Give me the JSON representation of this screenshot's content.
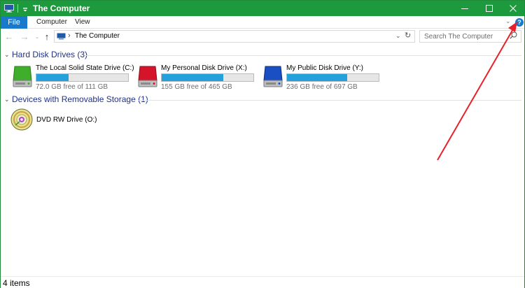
{
  "window": {
    "title": "The Computer"
  },
  "ribbon": {
    "file_label": "File",
    "tabs": [
      "Computer",
      "View"
    ],
    "help_glyph": "?"
  },
  "nav": {
    "crumb": "The Computer"
  },
  "search": {
    "placeholder": "Search The Computer"
  },
  "groups": [
    {
      "title": "Hard Disk Drives (3)"
    },
    {
      "title": "Devices with Removable Storage (1)"
    }
  ],
  "drives": [
    {
      "name": "The Local Solid State Drive (C:)",
      "free_text": "72.0 GB free of 111 GB",
      "used_fraction": 0.35,
      "icon": "green-hard-drive-icon",
      "color": "#3fae2a"
    },
    {
      "name": "My Personal Disk Drive (X:)",
      "free_text": "155 GB free of 465 GB",
      "used_fraction": 0.67,
      "icon": "red-hard-drive-icon",
      "color": "#d5142a"
    },
    {
      "name": "My Public Disk Drive (Y:)",
      "free_text": "236 GB free of 697 GB",
      "used_fraction": 0.66,
      "icon": "blue-hard-drive-icon",
      "color": "#1a4fc4"
    }
  ],
  "removable": [
    {
      "name": "DVD RW Drive (O:)",
      "icon": "dvd-drive-icon"
    }
  ],
  "status": {
    "item_count": "4 items"
  },
  "colors": {
    "titlebar": "#1e9a3e",
    "file_tab": "#1979ca",
    "group_title": "#1e3287",
    "usage_bar": "#26a0da",
    "annotation_arrow": "#e8202a"
  }
}
